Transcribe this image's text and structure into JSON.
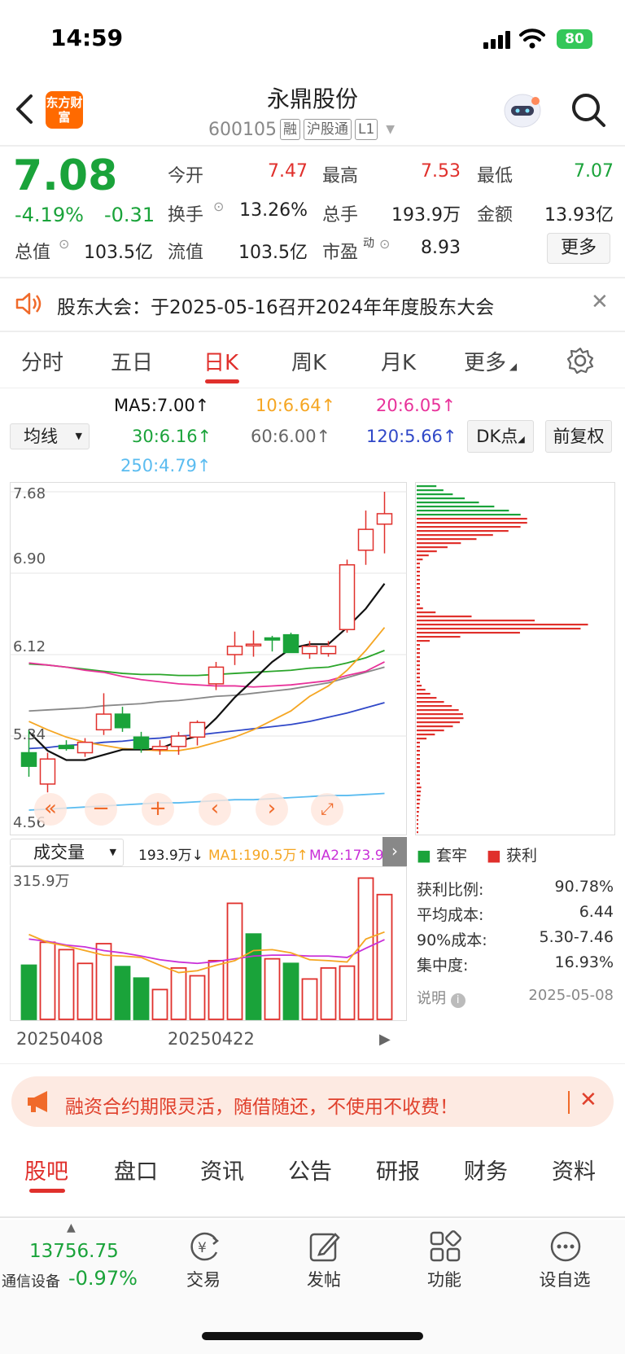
{
  "status_bar": {
    "time": "14:59",
    "battery": "80"
  },
  "header": {
    "logo_text": "东方财富",
    "title": "永鼎股份",
    "code": "600105",
    "tags": [
      "融",
      "沪股通",
      "L1"
    ]
  },
  "quote": {
    "price": "7.08",
    "change_pct": "-4.19%",
    "change_abs": "-0.31",
    "fields": {
      "open_label": "今开",
      "open": "7.47",
      "high_label": "最高",
      "high": "7.53",
      "low_label": "最低",
      "low": "7.07",
      "turnover_label": "换手",
      "turnover": "13.26%",
      "volume_label": "总手",
      "volume": "193.9万",
      "amount_label": "金额",
      "amount": "13.93亿",
      "mktcap_label": "总值",
      "mktcap": "103.5亿",
      "float_label": "流值",
      "float": "103.5亿",
      "pe_label": "市盈",
      "pe_sup": "动",
      "pe": "8.93"
    },
    "more_button": "更多"
  },
  "notice": {
    "text": "股东大会：于2025-05-16召开2024年年度股东大会"
  },
  "period_tabs": [
    "分时",
    "五日",
    "日K",
    "周K",
    "月K",
    "更多"
  ],
  "active_period": "日K",
  "ma_legend": {
    "ma5": "MA5:7.00↑",
    "ma10": "10:6.64↑",
    "ma20": "20:6.05↑",
    "ma30": "30:6.16↑",
    "ma60": "60:6.00↑",
    "ma120": "120:5.66↑",
    "ma250": "250:4.79↑",
    "selector": "均线",
    "dk_button": "DK点",
    "adjust_button": "前复权"
  },
  "colors": {
    "up": "#e0302c",
    "down": "#1aa33a",
    "ma5": "#111111",
    "ma10": "#f5a623",
    "ma20": "#e8329a",
    "ma30": "#2aa52a",
    "ma60": "#888888",
    "ma120": "#3048c8",
    "ma250": "#5bbcf0"
  },
  "price_axis": [
    "7.68",
    "6.90",
    "6.12",
    "5.34",
    "4.56"
  ],
  "volume": {
    "selector": "成交量",
    "current": "193.9万↓",
    "ma1": "MA1:190.5万↑",
    "ma2": "MA2:173.9万↑",
    "max_label": "315.9万",
    "dates": [
      "20250408",
      "20250422"
    ]
  },
  "chip": {
    "legend_loss": "套牢",
    "legend_profit": "获利",
    "rows": [
      {
        "label": "获利比例:",
        "value": "90.78%"
      },
      {
        "label": "平均成本:",
        "value": "6.44"
      },
      {
        "label": "90%成本:",
        "value": "5.30-7.46"
      },
      {
        "label": "集中度:",
        "value": "16.93%"
      }
    ],
    "note_label": "说明",
    "date": "2025-05-08"
  },
  "chart_data": {
    "type": "candlestick",
    "ylim": [
      4.56,
      7.68
    ],
    "candles": [
      {
        "o": 5.18,
        "h": 5.4,
        "l": 4.95,
        "c": 5.05
      },
      {
        "o": 4.88,
        "h": 5.18,
        "l": 4.8,
        "c": 5.12
      },
      {
        "o": 5.25,
        "h": 5.3,
        "l": 5.2,
        "c": 5.22
      },
      {
        "o": 5.18,
        "h": 5.32,
        "l": 5.14,
        "c": 5.28
      },
      {
        "o": 5.4,
        "h": 5.75,
        "l": 5.35,
        "c": 5.55
      },
      {
        "o": 5.55,
        "h": 5.62,
        "l": 5.38,
        "c": 5.42
      },
      {
        "o": 5.33,
        "h": 5.38,
        "l": 5.18,
        "c": 5.22
      },
      {
        "o": 5.21,
        "h": 5.3,
        "l": 5.16,
        "c": 5.24
      },
      {
        "o": 5.24,
        "h": 5.38,
        "l": 5.16,
        "c": 5.34
      },
      {
        "o": 5.33,
        "h": 5.49,
        "l": 5.25,
        "c": 5.47
      },
      {
        "o": 5.84,
        "h": 6.05,
        "l": 5.78,
        "c": 6.0
      },
      {
        "o": 6.12,
        "h": 6.34,
        "l": 6.02,
        "c": 6.2
      },
      {
        "o": 6.21,
        "h": 6.35,
        "l": 6.1,
        "c": 6.22
      },
      {
        "o": 6.28,
        "h": 6.3,
        "l": 6.15,
        "c": 6.26
      },
      {
        "o": 6.31,
        "h": 6.33,
        "l": 6.14,
        "c": 6.14
      },
      {
        "o": 6.13,
        "h": 6.25,
        "l": 6.08,
        "c": 6.2
      },
      {
        "o": 6.13,
        "h": 6.25,
        "l": 6.1,
        "c": 6.2
      },
      {
        "o": 6.36,
        "h": 7.03,
        "l": 6.33,
        "c": 6.98
      },
      {
        "o": 7.12,
        "h": 7.5,
        "l": 6.98,
        "c": 7.32
      },
      {
        "o": 7.37,
        "h": 7.68,
        "l": 7.09,
        "c": 7.47
      }
    ],
    "ma5": [
      5.38,
      5.2,
      5.11,
      5.11,
      5.16,
      5.21,
      5.21,
      5.22,
      5.29,
      5.34,
      5.51,
      5.71,
      5.88,
      6.05,
      6.18,
      6.22,
      6.22,
      6.38,
      6.56,
      6.8
    ],
    "ma10": [
      5.48,
      5.4,
      5.33,
      5.28,
      5.25,
      5.22,
      5.21,
      5.2,
      5.2,
      5.23,
      5.28,
      5.33,
      5.4,
      5.49,
      5.58,
      5.72,
      5.82,
      5.97,
      6.16,
      6.38
    ],
    "ma20": [
      6.04,
      6.02,
      6.0,
      5.97,
      5.95,
      5.91,
      5.88,
      5.86,
      5.84,
      5.83,
      5.82,
      5.82,
      5.81,
      5.82,
      5.83,
      5.85,
      5.87,
      5.92,
      5.96,
      6.05
    ],
    "ma30": [
      6.03,
      6.02,
      6.0,
      5.98,
      5.96,
      5.94,
      5.93,
      5.93,
      5.92,
      5.92,
      5.93,
      5.94,
      5.95,
      5.96,
      5.97,
      5.99,
      6.0,
      6.04,
      6.09,
      6.16
    ],
    "ma60": [
      5.58,
      5.59,
      5.6,
      5.61,
      5.63,
      5.64,
      5.65,
      5.67,
      5.68,
      5.7,
      5.72,
      5.73,
      5.75,
      5.77,
      5.79,
      5.82,
      5.85,
      5.9,
      5.95,
      6.0
    ],
    "ma120": [
      5.22,
      5.23,
      5.25,
      5.26,
      5.28,
      5.29,
      5.31,
      5.32,
      5.34,
      5.35,
      5.37,
      5.39,
      5.41,
      5.43,
      5.45,
      5.48,
      5.52,
      5.56,
      5.61,
      5.66
    ],
    "ma250": [
      4.63,
      4.64,
      4.65,
      4.66,
      4.67,
      4.68,
      4.69,
      4.7,
      4.7,
      4.71,
      4.72,
      4.73,
      4.73,
      4.74,
      4.75,
      4.76,
      4.77,
      4.77,
      4.78,
      4.79
    ],
    "volume_wan": [
      118,
      168,
      152,
      122,
      165,
      115,
      90,
      65,
      112,
      95,
      128,
      253,
      186,
      132,
      122,
      88,
      112,
      116,
      308,
      272
    ],
    "volume_up": [
      false,
      true,
      true,
      true,
      true,
      false,
      false,
      true,
      true,
      true,
      true,
      true,
      false,
      true,
      false,
      true,
      true,
      true,
      true,
      true
    ],
    "vol_ylim": [
      0,
      315.9
    ],
    "vol_ma1": [
      185,
      168,
      160,
      150,
      140,
      138,
      135,
      118,
      102,
      106,
      118,
      128,
      150,
      152,
      145,
      130,
      128,
      125,
      175,
      190.5
    ],
    "vol_ma2": [
      175,
      170,
      162,
      158,
      150,
      145,
      138,
      130,
      125,
      122,
      126,
      132,
      138,
      140,
      140,
      138,
      138,
      135,
      155,
      173.9
    ]
  },
  "ad_banner": {
    "text": "融资合约期限灵活，随借随还，不使用不收费！"
  },
  "content_tabs": [
    "股吧",
    "盘口",
    "资讯",
    "公告",
    "研报",
    "财务",
    "资料"
  ],
  "bottom_bar": {
    "index_value": "13756.75",
    "index_name": "通信设备",
    "index_change": "-0.97%",
    "items": [
      "交易",
      "发帖",
      "功能",
      "设自选"
    ]
  }
}
